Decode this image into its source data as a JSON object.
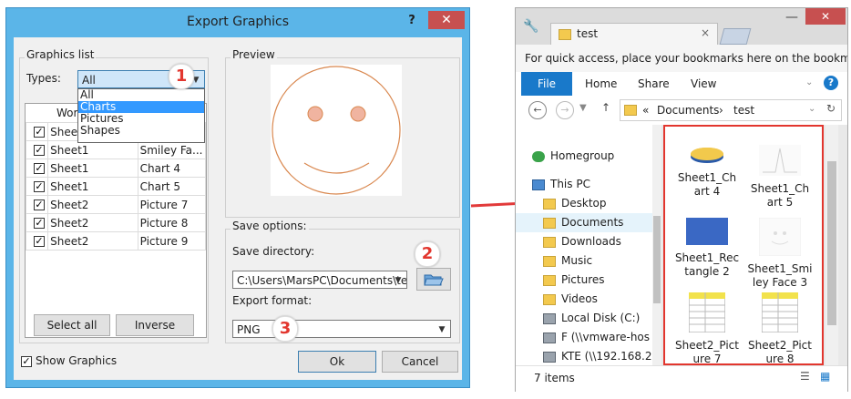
{
  "dialog": {
    "title": "Export Graphics",
    "help_label": "?",
    "close_label": "✕",
    "graphics_list_label": "Graphics list",
    "types_label": "Types:",
    "types_value": "All",
    "types_options": [
      "All",
      "Charts",
      "Pictures",
      "Shapes"
    ],
    "table_header_partial": "Wor",
    "rows": [
      {
        "checked": true,
        "sheet": "Sheet",
        "name": ""
      },
      {
        "checked": true,
        "sheet": "Sheet1",
        "name": "Smiley Fa..."
      },
      {
        "checked": true,
        "sheet": "Sheet1",
        "name": "Chart 4"
      },
      {
        "checked": true,
        "sheet": "Sheet1",
        "name": "Chart 5"
      },
      {
        "checked": true,
        "sheet": "Sheet2",
        "name": "Picture 7"
      },
      {
        "checked": true,
        "sheet": "Sheet2",
        "name": "Picture 8"
      },
      {
        "checked": true,
        "sheet": "Sheet2",
        "name": "Picture 9"
      }
    ],
    "select_all_label": "Select all",
    "inverse_label": "Inverse",
    "show_graphics_label": "Show Graphics",
    "preview_label": "Preview",
    "save_options_label": "Save options:",
    "save_directory_label": "Save directory:",
    "save_directory_value": "C:\\Users\\MarsPC\\Documents\\te",
    "export_format_label": "Export format:",
    "export_format_value": "PNG",
    "ok_label": "Ok",
    "cancel_label": "Cancel",
    "badges": [
      "1",
      "2",
      "3"
    ]
  },
  "explorer": {
    "tab_title": "test",
    "bookmarks_text": "For quick access, place your bookmarks here on the bookm...",
    "ribbon_tabs": [
      "File",
      "Home",
      "Share",
      "View"
    ],
    "help_label": "?",
    "breadcrumb": [
      "«",
      "Documents",
      "›",
      "test"
    ],
    "nav": [
      {
        "label": "Homegroup",
        "icon": "homegroup-icon"
      },
      {
        "label": "This PC",
        "icon": "computer-icon"
      },
      {
        "label": "Desktop",
        "icon": "folder-icon"
      },
      {
        "label": "Documents",
        "icon": "folder-icon"
      },
      {
        "label": "Downloads",
        "icon": "folder-icon"
      },
      {
        "label": "Music",
        "icon": "folder-icon"
      },
      {
        "label": "Pictures",
        "icon": "folder-icon"
      },
      {
        "label": "Videos",
        "icon": "folder-icon"
      },
      {
        "label": "Local Disk (C:)",
        "icon": "drive-icon"
      },
      {
        "label": "F (\\\\vmware-hos",
        "icon": "network-drive-icon"
      },
      {
        "label": "KTE (\\\\192.168.2",
        "icon": "network-drive-icon"
      }
    ],
    "files": [
      {
        "label": "Sheet1_Chart 4",
        "line1": "Sheet1_Ch",
        "line2": "art 4"
      },
      {
        "label": "Sheet1_Chart 5",
        "line1": "Sheet1_Ch",
        "line2": "art 5"
      },
      {
        "label": "Sheet1_Rectangle 2",
        "line1": "Sheet1_Rec",
        "line2": "tangle 2"
      },
      {
        "label": "Sheet1_Smiley Face 3",
        "line1": "Sheet1_Smi",
        "line2": "ley Face 3"
      },
      {
        "label": "Sheet2_Picture 7",
        "line1": "Sheet2_Pict",
        "line2": "ure 7"
      },
      {
        "label": "Sheet2_Picture 8",
        "line1": "Sheet2_Pict",
        "line2": "ure 8"
      }
    ],
    "status": "7 items"
  },
  "colors": {
    "dialog_frame": "#5bb5e8",
    "close_red": "#c75050",
    "highlight_red": "#e2362e",
    "selection_blue": "#3399ff",
    "file_tab_blue": "#1979ca",
    "arrow_red": "#e23a3a"
  }
}
